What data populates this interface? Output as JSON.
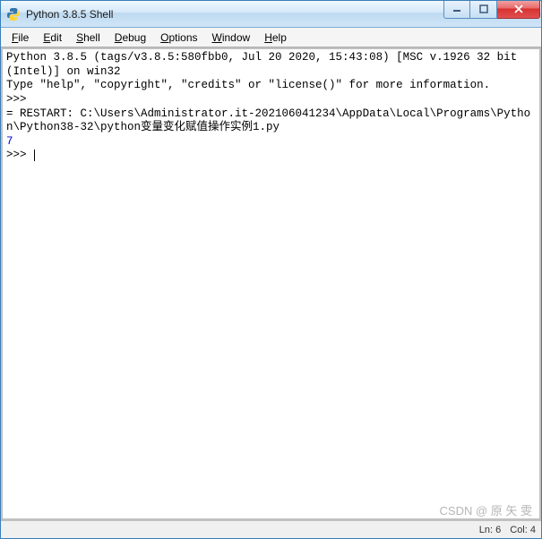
{
  "window": {
    "title": "Python 3.8.5 Shell"
  },
  "menu": {
    "file": "File",
    "edit": "Edit",
    "shell": "Shell",
    "debug": "Debug",
    "options": "Options",
    "window": "Window",
    "help": "Help"
  },
  "shell": {
    "banner1": "Python 3.8.5 (tags/v3.8.5:580fbb0, Jul 20 2020, 15:43:08) [MSC v.1926 32 bit (Intel)] on win32",
    "banner2": "Type \"help\", \"copyright\", \"credits\" or \"license()\" for more information.",
    "prompt1": ">>> ",
    "restart": "= RESTART: C:\\Users\\Administrator.it-202106041234\\AppData\\Local\\Programs\\Python\\Python38-32\\python变量变化赋值操作实例1.py",
    "output1": "7",
    "prompt2": ">>> "
  },
  "status": {
    "ln_label": "Ln:",
    "ln_value": "6",
    "col_label": "Col:",
    "col_value": "4"
  },
  "watermark": "CSDN @ 原 矢 雯"
}
